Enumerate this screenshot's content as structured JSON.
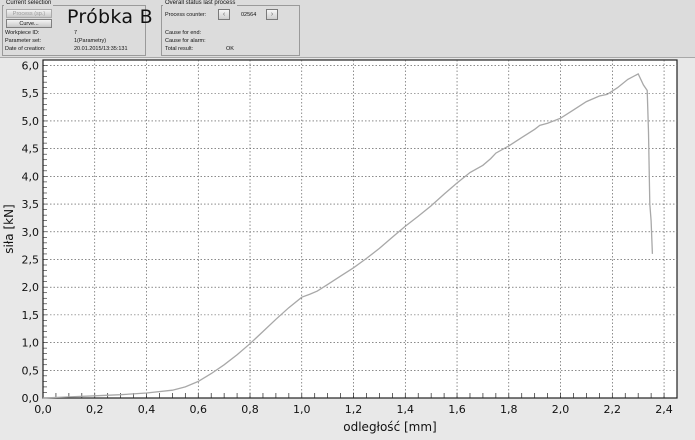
{
  "header": {
    "current_selection": {
      "title": "Current selection",
      "process_btn": "Process (sp.)",
      "curve_btn": "Curve...",
      "big_title": "Próbka B",
      "rows": [
        {
          "label": "Workpiece ID:",
          "value": "7"
        },
        {
          "label": "Parameter set:",
          "value": "1(Parametry)"
        },
        {
          "label": "Date of creation:",
          "value": "20.01.2015/13:35:131"
        }
      ]
    },
    "overall_status": {
      "title": "Overall status last process",
      "counter_label": "Process counter:",
      "counter_value": "02564",
      "prev_icon": "chevron-left-icon",
      "next_icon": "chevron-right-icon",
      "rows": [
        {
          "label": "Cause for end:",
          "value": ""
        },
        {
          "label": "Cause for alarm:",
          "value": ""
        },
        {
          "label": "Total result:",
          "value": "OK"
        }
      ]
    }
  },
  "chart_data": {
    "type": "line",
    "xlabel": "odległość [mm]",
    "ylabel": "siła [kN]",
    "xlim": [
      0,
      2.45
    ],
    "ylim": [
      0,
      6.1
    ],
    "x_ticks": [
      "0,0",
      "0,2",
      "0,4",
      "0,6",
      "0,8",
      "1,0",
      "1,2",
      "1,4",
      "1,6",
      "1,8",
      "2,0",
      "2,2",
      "2,4"
    ],
    "y_ticks": [
      "0,0",
      "0,5",
      "1,0",
      "1,5",
      "2,0",
      "2,5",
      "3,0",
      "3,5",
      "4,0",
      "4,5",
      "5,0",
      "5,5",
      "6,0"
    ],
    "grid": true,
    "line_color": "#a8a8a8",
    "series": [
      {
        "x": [
          0.0,
          0.1,
          0.2,
          0.3,
          0.4,
          0.5,
          0.55,
          0.6,
          0.65,
          0.7,
          0.75,
          0.8,
          0.85,
          0.9,
          0.95,
          1.0,
          1.03,
          1.06,
          1.1,
          1.15,
          1.2,
          1.25,
          1.3,
          1.35,
          1.4,
          1.45,
          1.5,
          1.55,
          1.6,
          1.65,
          1.7,
          1.73,
          1.75,
          1.8,
          1.85,
          1.9,
          1.92,
          1.95,
          2.0,
          2.05,
          2.1,
          2.15,
          2.18,
          2.22,
          2.26,
          2.3,
          2.32,
          2.335,
          2.34,
          2.345,
          2.35,
          2.355
        ],
        "y": [
          0.0,
          0.02,
          0.04,
          0.06,
          0.09,
          0.14,
          0.2,
          0.3,
          0.44,
          0.6,
          0.78,
          0.98,
          1.2,
          1.42,
          1.63,
          1.82,
          1.87,
          1.93,
          2.05,
          2.2,
          2.35,
          2.52,
          2.7,
          2.9,
          3.1,
          3.28,
          3.47,
          3.68,
          3.88,
          4.07,
          4.2,
          4.32,
          4.42,
          4.55,
          4.7,
          4.85,
          4.92,
          4.96,
          5.05,
          5.2,
          5.35,
          5.45,
          5.48,
          5.6,
          5.75,
          5.85,
          5.65,
          5.55,
          4.8,
          3.5,
          3.2,
          2.6
        ]
      }
    ]
  }
}
